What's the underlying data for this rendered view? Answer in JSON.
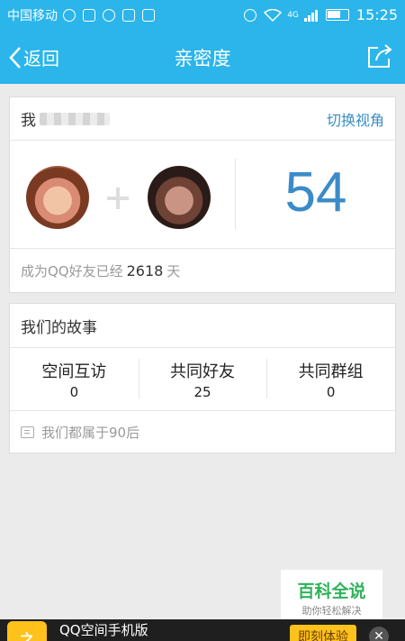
{
  "status_bar": {
    "carrier": "中国移动",
    "network": "4G",
    "time": "15:25",
    "battery_level": 0.65
  },
  "header": {
    "back_label": "返回",
    "title": "亲密度"
  },
  "intimacy": {
    "me_label": "我",
    "switch_view": "切换视角",
    "score": "54",
    "friend_prefix": "成为QQ好友已经",
    "days": "2618",
    "days_unit": "天"
  },
  "story": {
    "title": "我们的故事",
    "stats": [
      {
        "label": "空间互访",
        "value": "0"
      },
      {
        "label": "共同好友",
        "value": "25"
      },
      {
        "label": "共同群组",
        "value": "0"
      }
    ],
    "note": "我们都属于90后"
  },
  "watermark": {
    "title": "百科全说",
    "subtitle": "助你轻松解决"
  },
  "ad": {
    "app_name": "QQ空间手机版",
    "cta": "即刻体验",
    "close": "✕"
  },
  "colors": {
    "brand_blue": "#2bb5ea",
    "score_blue": "#3b8bc8",
    "link_blue": "#3a8cc4",
    "watermark_green": "#2fb25a",
    "ad_yellow": "#ffc21a"
  }
}
